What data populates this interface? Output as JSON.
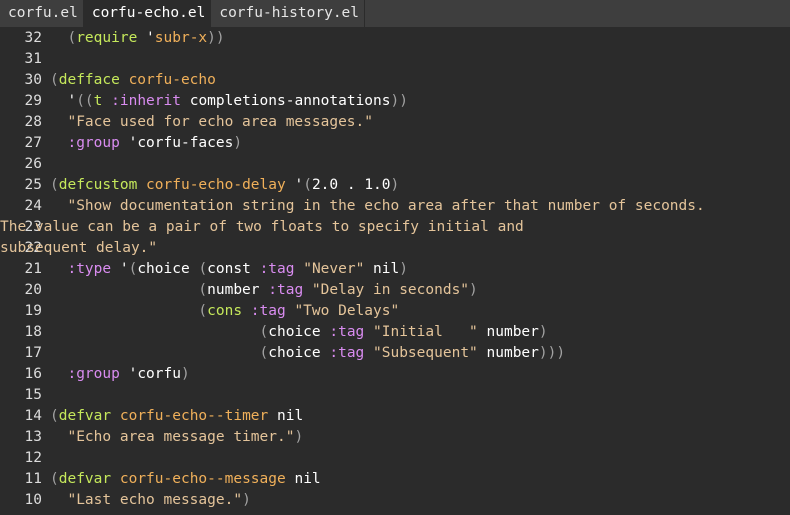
{
  "tabs": [
    {
      "label": "corfu.el",
      "active": false
    },
    {
      "label": "corfu-echo.el",
      "active": true
    },
    {
      "label": "corfu-history.el",
      "active": false
    }
  ],
  "lines": [
    {
      "n": "32",
      "seg": [
        [
          "p",
          "  ("
        ],
        [
          "kw",
          "require"
        ],
        [
          "tx",
          " '"
        ],
        [
          "fn",
          "subr-x"
        ],
        [
          "p",
          "))"
        ]
      ]
    },
    {
      "n": "31",
      "seg": []
    },
    {
      "n": "30",
      "seg": [
        [
          "p",
          "("
        ],
        [
          "kw",
          "defface"
        ],
        [
          "tx",
          " "
        ],
        [
          "fn",
          "corfu-echo"
        ]
      ]
    },
    {
      "n": "29",
      "seg": [
        [
          "tx",
          "  '"
        ],
        [
          "p",
          "(("
        ],
        [
          "kw",
          "t"
        ],
        [
          "tx",
          " "
        ],
        [
          "kv",
          ":inherit"
        ],
        [
          "tx",
          " completions-annotations"
        ],
        [
          "p",
          "))"
        ]
      ]
    },
    {
      "n": "28",
      "seg": [
        [
          "st",
          "  \"Face used for echo area messages.\""
        ]
      ]
    },
    {
      "n": "27",
      "seg": [
        [
          "tx",
          "  "
        ],
        [
          "kv",
          ":group"
        ],
        [
          "tx",
          " 'corfu-faces"
        ],
        [
          "p",
          ")"
        ]
      ]
    },
    {
      "n": "26",
      "seg": []
    },
    {
      "n": "25",
      "seg": [
        [
          "p",
          "("
        ],
        [
          "kw",
          "defcustom"
        ],
        [
          "tx",
          " "
        ],
        [
          "fn",
          "corfu-echo-delay"
        ],
        [
          "tx",
          " '"
        ],
        [
          "p",
          "("
        ],
        [
          "tx",
          "2.0 . 1.0"
        ],
        [
          "p",
          ")"
        ]
      ]
    },
    {
      "n": "24",
      "seg": [
        [
          "st",
          "  \"Show documentation string in the echo area after that number of seconds."
        ]
      ]
    },
    {
      "n": "23",
      "wrap": true,
      "seg": [
        [
          "st",
          "The value can be a pair of two floats to specify initial and"
        ]
      ]
    },
    {
      "n": "22",
      "wrap": true,
      "seg": [
        [
          "st",
          "subsequent delay.\""
        ]
      ]
    },
    {
      "n": "21",
      "seg": [
        [
          "tx",
          "  "
        ],
        [
          "kv",
          ":type"
        ],
        [
          "tx",
          " '"
        ],
        [
          "p",
          "("
        ],
        [
          "tx",
          "choice "
        ],
        [
          "p",
          "("
        ],
        [
          "tx",
          "const "
        ],
        [
          "kv",
          ":tag"
        ],
        [
          "tx",
          " "
        ],
        [
          "st",
          "\"Never\""
        ],
        [
          "tx",
          " nil"
        ],
        [
          "p",
          ")"
        ]
      ]
    },
    {
      "n": "20",
      "seg": [
        [
          "tx",
          "                 "
        ],
        [
          "p",
          "("
        ],
        [
          "tx",
          "number "
        ],
        [
          "kv",
          ":tag"
        ],
        [
          "tx",
          " "
        ],
        [
          "st",
          "\"Delay in seconds\""
        ],
        [
          "p",
          ")"
        ]
      ]
    },
    {
      "n": "19",
      "seg": [
        [
          "tx",
          "                 "
        ],
        [
          "p",
          "("
        ],
        [
          "kw",
          "cons"
        ],
        [
          "tx",
          " "
        ],
        [
          "kv",
          ":tag"
        ],
        [
          "tx",
          " "
        ],
        [
          "st",
          "\"Two Delays\""
        ]
      ]
    },
    {
      "n": "18",
      "seg": [
        [
          "tx",
          "                        "
        ],
        [
          "p",
          "("
        ],
        [
          "tx",
          "choice "
        ],
        [
          "kv",
          ":tag"
        ],
        [
          "tx",
          " "
        ],
        [
          "st",
          "\"Initial   \""
        ],
        [
          "tx",
          " number"
        ],
        [
          "p",
          ")"
        ]
      ]
    },
    {
      "n": "17",
      "seg": [
        [
          "tx",
          "                        "
        ],
        [
          "p",
          "("
        ],
        [
          "tx",
          "choice "
        ],
        [
          "kv",
          ":tag"
        ],
        [
          "tx",
          " "
        ],
        [
          "st",
          "\"Subsequent\""
        ],
        [
          "tx",
          " number"
        ],
        [
          "p",
          ")))"
        ]
      ]
    },
    {
      "n": "16",
      "seg": [
        [
          "tx",
          "  "
        ],
        [
          "kv",
          ":group"
        ],
        [
          "tx",
          " 'corfu"
        ],
        [
          "p",
          ")"
        ]
      ]
    },
    {
      "n": "15",
      "seg": []
    },
    {
      "n": "14",
      "seg": [
        [
          "p",
          "("
        ],
        [
          "kw",
          "defvar"
        ],
        [
          "tx",
          " "
        ],
        [
          "fn",
          "corfu-echo--timer"
        ],
        [
          "tx",
          " nil"
        ]
      ]
    },
    {
      "n": "13",
      "seg": [
        [
          "st",
          "  \"Echo area message timer.\""
        ],
        [
          "p",
          ")"
        ]
      ]
    },
    {
      "n": "12",
      "seg": []
    },
    {
      "n": "11",
      "seg": [
        [
          "p",
          "("
        ],
        [
          "kw",
          "defvar"
        ],
        [
          "tx",
          " "
        ],
        [
          "fn",
          "corfu-echo--message"
        ],
        [
          "tx",
          " nil"
        ]
      ]
    },
    {
      "n": "10",
      "seg": [
        [
          "st",
          "  \"Last echo message.\""
        ],
        [
          "p",
          ")"
        ]
      ]
    }
  ]
}
